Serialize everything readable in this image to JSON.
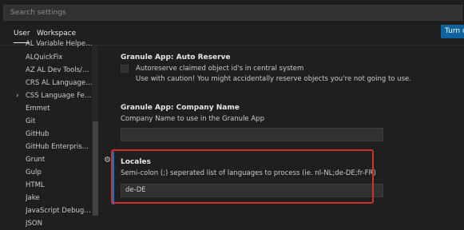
{
  "search": {
    "placeholder": "Search settings"
  },
  "tabs": {
    "user": "User",
    "workspace": "Workspace"
  },
  "turn_on_button": "Turn on",
  "tree": {
    "cut_item": "AL Variable Helper ...",
    "items": [
      {
        "label": "ALQuickFix",
        "expandable": false
      },
      {
        "label": "AZ AL Dev Tools/A...",
        "expandable": false
      },
      {
        "label": "CRS AL Language E...",
        "expandable": false
      },
      {
        "label": "CSS Language Feat...",
        "expandable": true
      },
      {
        "label": "Emmet",
        "expandable": false
      },
      {
        "label": "Git",
        "expandable": false
      },
      {
        "label": "GitHub",
        "expandable": false
      },
      {
        "label": "GitHub Enterprise ...",
        "expandable": false
      },
      {
        "label": "Grunt",
        "expandable": false
      },
      {
        "label": "Gulp",
        "expandable": false
      },
      {
        "label": "HTML",
        "expandable": false
      },
      {
        "label": "Jake",
        "expandable": false
      },
      {
        "label": "JavaScript Debugger",
        "expandable": false
      },
      {
        "label": "JSON",
        "expandable": false
      }
    ]
  },
  "settings": {
    "auto_reserve": {
      "category": "Granule App: ",
      "name": "Auto Reserve",
      "checkbox_label": "Autoreserve claimed object id's in central system",
      "caution": "Use with caution! You might accidentally reserve objects you're not going to use.",
      "checked": false
    },
    "company_name": {
      "category": "Granule App: ",
      "name": "Company Name",
      "description": "Company Name to use in the Granule App",
      "value": ""
    },
    "locales": {
      "name": "Locales",
      "description": "Semi-colon (;) seperated list of languages to process (ie. nl-NL;de-DE;fr-FR)",
      "value": "de-DE"
    }
  },
  "colors": {
    "accent": "#0078d4",
    "highlight": "#d32f2f",
    "button": "#0e639c"
  }
}
